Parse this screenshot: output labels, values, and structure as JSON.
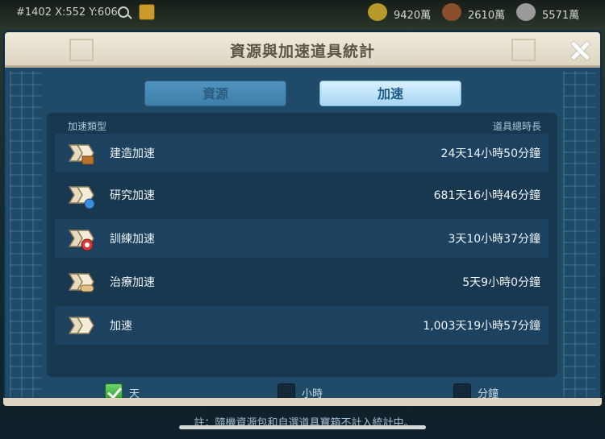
{
  "hud": {
    "coords": "#1402 X:552 Y:606",
    "resources": [
      {
        "value": "9420萬",
        "icon": "food-icon"
      },
      {
        "value": "2610萬",
        "icon": "wood-icon"
      },
      {
        "value": "5571萬",
        "icon": "stone-icon"
      }
    ]
  },
  "dialog": {
    "title": "資源與加速道具統計",
    "tabs": [
      "資源",
      "加速"
    ],
    "active_tab": "加速",
    "header_type": "加速類型",
    "header_total": "道具總時長",
    "rows": [
      {
        "name": "建造加速",
        "duration": "24天14小時50分鐘",
        "icon": "building-speedup-icon"
      },
      {
        "name": "研究加速",
        "duration": "681天16小時46分鐘",
        "icon": "research-speedup-icon"
      },
      {
        "name": "訓練加速",
        "duration": "3天10小時37分鐘",
        "icon": "training-speedup-icon"
      },
      {
        "name": "治療加速",
        "duration": "5天9小時0分鐘",
        "icon": "healing-speedup-icon"
      },
      {
        "name": "加速",
        "duration": "1,003天19小時57分鐘",
        "icon": "universal-speedup-icon"
      }
    ],
    "units": [
      {
        "label": "天",
        "checked": true
      },
      {
        "label": "小時",
        "checked": false
      },
      {
        "label": "分鐘",
        "checked": false
      }
    ],
    "note": "註：隨機資源包和自選道具寶箱不計入統計中。"
  }
}
